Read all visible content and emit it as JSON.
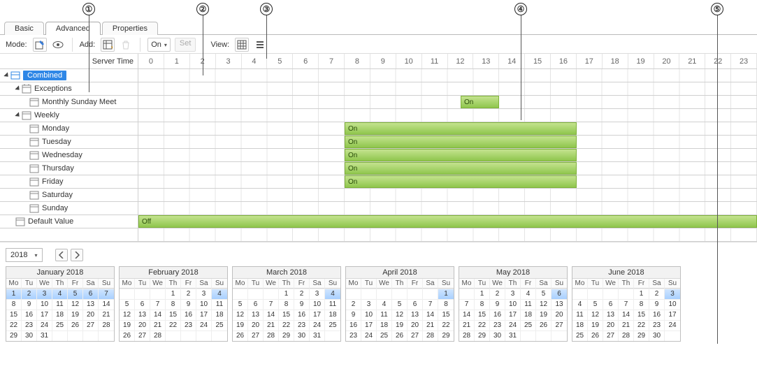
{
  "callouts": [
    "①",
    "②",
    "③",
    "④",
    "⑤"
  ],
  "tabs": {
    "basic": "Basic",
    "advanced": "Advanced",
    "properties": "Properties"
  },
  "toolbar": {
    "mode": "Mode:",
    "add": "Add:",
    "on_value": "On",
    "set": "Set",
    "view": "View:",
    "server_time": "Server Time"
  },
  "hours": [
    "0",
    "1",
    "2",
    "3",
    "4",
    "5",
    "6",
    "7",
    "8",
    "9",
    "10",
    "11",
    "12",
    "13",
    "14",
    "15",
    "16",
    "17",
    "18",
    "19",
    "20",
    "21",
    "22",
    "23"
  ],
  "tree": {
    "combined": "Combined",
    "exceptions": "Exceptions",
    "monthly": "Monthly Sunday Meet",
    "weekly": "Weekly",
    "days": [
      "Monday",
      "Tuesday",
      "Wednesday",
      "Thursday",
      "Friday",
      "Saturday",
      "Sunday"
    ],
    "default": "Default Value"
  },
  "bar_labels": {
    "on": "On",
    "off": "Off"
  },
  "bottom": {
    "year": "2018",
    "dow": [
      "Mo",
      "Tu",
      "We",
      "Th",
      "Fr",
      "Sa",
      "Su"
    ],
    "months": [
      {
        "title": "January 2018",
        "lead": 0,
        "days": 31,
        "selected": [
          1,
          2,
          3,
          4,
          5,
          6,
          7
        ]
      },
      {
        "title": "February 2018",
        "lead": 3,
        "days": 28,
        "selected": [
          4
        ]
      },
      {
        "title": "March 2018",
        "lead": 3,
        "days": 31,
        "selected": [
          4
        ]
      },
      {
        "title": "April 2018",
        "lead": 6,
        "days": 30,
        "selected": [
          1
        ]
      },
      {
        "title": "May 2018",
        "lead": 1,
        "days": 31,
        "selected": [
          6
        ]
      },
      {
        "title": "June 2018",
        "lead": 4,
        "days": 30,
        "selected": [
          3
        ]
      }
    ]
  }
}
